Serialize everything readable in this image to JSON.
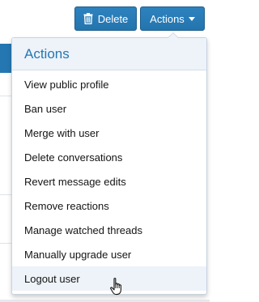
{
  "buttons": {
    "delete_label": "Delete",
    "actions_label": "Actions"
  },
  "menu": {
    "title": "Actions",
    "items": [
      {
        "label": "View public profile"
      },
      {
        "label": "Ban user"
      },
      {
        "label": "Merge with user"
      },
      {
        "label": "Delete conversations"
      },
      {
        "label": "Revert message edits"
      },
      {
        "label": "Remove reactions"
      },
      {
        "label": "Manage watched threads"
      },
      {
        "label": "Manually upgrade user"
      },
      {
        "label": "Logout user"
      }
    ],
    "hovered_item": "Logout user"
  },
  "colors": {
    "button": "#2577b1",
    "menu_header_bg": "#edf3f9",
    "menu_title": "#2577b1"
  },
  "icons": {
    "delete": "trash-icon",
    "actions": "caret-down-icon",
    "pointer": "hand-pointer-cursor-icon"
  }
}
